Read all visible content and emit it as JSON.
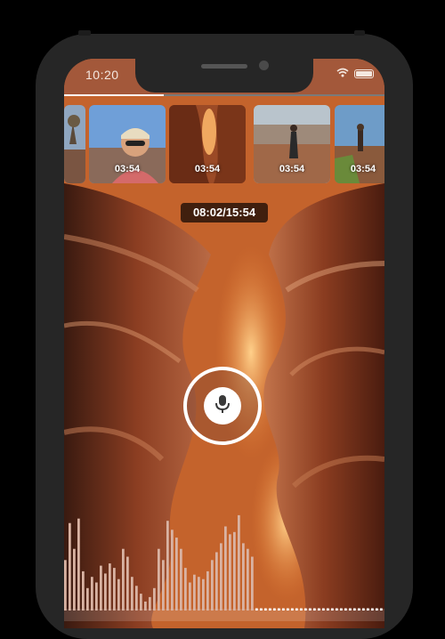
{
  "status_bar": {
    "time": "10:20",
    "icons": [
      "wifi-icon",
      "battery-icon"
    ]
  },
  "recording": {
    "progress": 0.31,
    "timecode": "08:02/15:54"
  },
  "clips": [
    {
      "duration": "",
      "scene": "canyon-tree"
    },
    {
      "duration": "03:54",
      "scene": "smiling-hiker"
    },
    {
      "duration": "03:54",
      "scene": "canyon-walls"
    },
    {
      "duration": "03:54",
      "scene": "canyon-lookout"
    },
    {
      "duration": "03:54",
      "scene": "hiker-on-rock"
    }
  ],
  "mic_button": {
    "icon": "microphone-icon"
  },
  "waveform": {
    "levels": [
      0.45,
      0.78,
      0.55,
      0.82,
      0.35,
      0.2,
      0.3,
      0.25,
      0.4,
      0.33,
      0.42,
      0.38,
      0.28,
      0.55,
      0.48,
      0.3,
      0.22,
      0.15,
      0.08,
      0.12,
      0.2,
      0.55,
      0.45,
      0.8,
      0.72,
      0.65,
      0.55,
      0.38,
      0.25,
      0.32,
      0.3,
      0.28,
      0.35,
      0.45,
      0.52,
      0.6,
      0.75,
      0.68,
      0.7,
      0.85,
      0.6,
      0.55,
      0.48,
      0.02,
      0.02,
      0.02,
      0.02,
      0.02,
      0.02,
      0.02,
      0.02,
      0.02,
      0.02,
      0.02,
      0.02,
      0.02,
      0.02,
      0.02,
      0.02,
      0.02,
      0.02,
      0.02,
      0.02,
      0.02,
      0.02,
      0.02,
      0.02,
      0.02,
      0.02,
      0.02,
      0.02,
      0.02
    ],
    "played_fraction": 0.6,
    "played_color": "#ffffff",
    "unplayed_color": "#d9b3a3"
  },
  "colors": {
    "accent": "#ffffff",
    "status_bar": "#a3583a",
    "frame": "#262626"
  }
}
